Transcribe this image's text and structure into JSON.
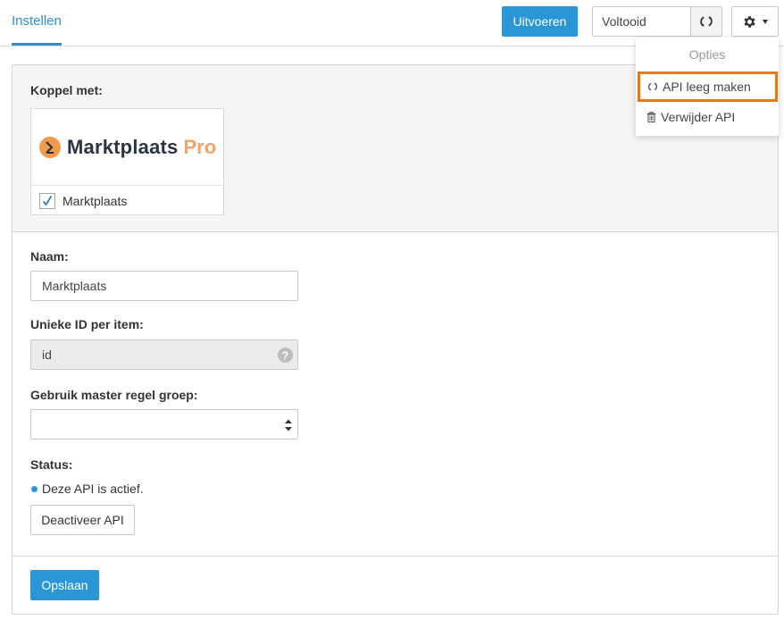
{
  "tabs": {
    "active": "Instellen"
  },
  "toolbar": {
    "run_label": "Uitvoeren",
    "status_value": "Voltooid",
    "refresh_icon": "refresh-icon",
    "settings_icon": "gear-icon"
  },
  "dropdown": {
    "header": "Opties",
    "items": [
      {
        "label": "API leeg maken",
        "icon": "refresh-icon"
      },
      {
        "label": "Verwijder API",
        "icon": "trash-icon"
      }
    ]
  },
  "connect": {
    "label": "Koppel met:",
    "logo_text": "Marktplaats",
    "logo_pro": "Pro",
    "option_label": "Marktplaats",
    "checked": true
  },
  "form": {
    "name_label": "Naam:",
    "name_value": "Marktplaats",
    "unique_id_label": "Unieke ID per item:",
    "unique_id_value": "id",
    "master_group_label": "Gebruik master regel groep:",
    "master_group_value": "",
    "status_label": "Status:",
    "status_text": "Deze API is actief.",
    "deactivate_label": "Deactiveer API",
    "save_label": "Opslaan"
  },
  "colors": {
    "accent": "#2a96d6",
    "highlight": "#e07b22",
    "logo_orange": "#f29a4c"
  }
}
